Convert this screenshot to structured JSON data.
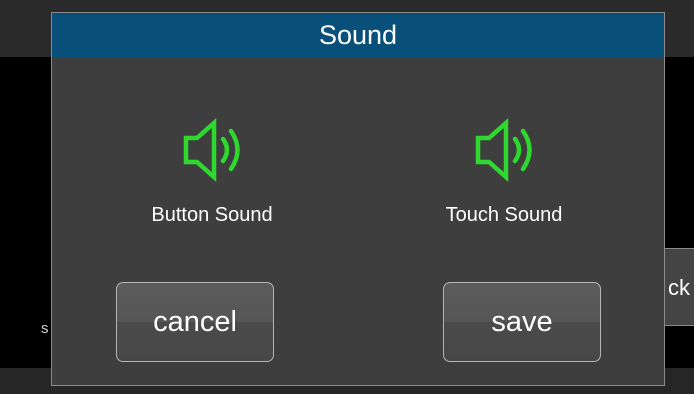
{
  "background": {
    "stub_text": "s",
    "back_button_label": "ck"
  },
  "dialog": {
    "title": "Sound",
    "options": [
      {
        "label": "Button Sound",
        "icon": "speaker-icon"
      },
      {
        "label": "Touch Sound",
        "icon": "speaker-icon"
      }
    ],
    "cancel_label": "cancel",
    "save_label": "save"
  },
  "colors": {
    "title_bar": "#08507a",
    "dialog_bg": "#3e3e3e",
    "icon_green": "#2fd82f"
  }
}
